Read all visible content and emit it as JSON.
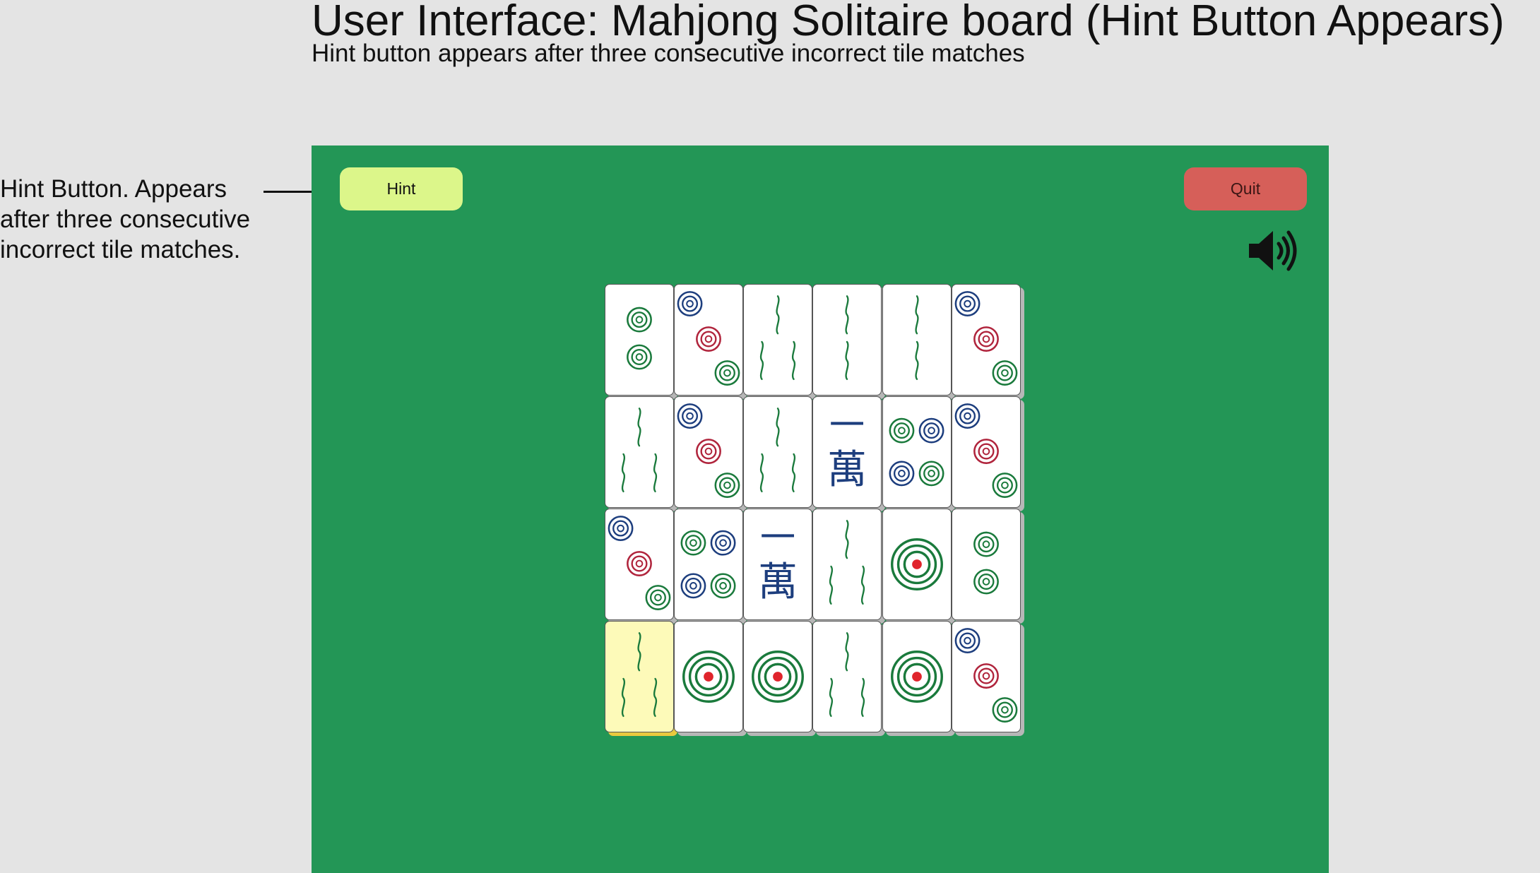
{
  "header": {
    "title": "User Interface: Mahjong Solitaire board (Hint Button Appears)",
    "subtitle": "Hint button appears after three consecutive incorrect tile matches"
  },
  "annotation": {
    "text": "Hint Button. Appears after three consecutive incorrect tile matches."
  },
  "toolbar": {
    "hint_label": "Hint",
    "quit_label": "Quit",
    "sound_icon": "speaker-volume-icon"
  },
  "colors": {
    "page_background": "#e4e4e4",
    "board_background": "#239656",
    "hint_button": "#dcf68a",
    "quit_button": "#d65f59",
    "tile_face": "#ffffff",
    "tile_selected": "#fdfab9",
    "dot_green": "#1a7a3c",
    "dot_blue": "#1d3e7e",
    "dot_red": "#b0243c",
    "bamboo_green": "#1a7a3c",
    "wan_blue": "#1d3e7e"
  },
  "wan_glyphs": {
    "top": "一",
    "bottom": "萬"
  },
  "tiles": {
    "rows": [
      [
        "dots-2",
        "dots-3",
        "bamboo-3",
        "bamboo-2",
        "bamboo-2",
        "dots-3"
      ],
      [
        "bamboo-3",
        "dots-3",
        "bamboo-3",
        "character-1",
        "dots-4",
        "dots-3"
      ],
      [
        "dots-3",
        "dots-4",
        "character-1",
        "bamboo-3",
        "dots-1",
        "dots-2"
      ],
      [
        "bamboo-3",
        "dots-1",
        "dots-1",
        "bamboo-3",
        "dots-1",
        "dots-3"
      ]
    ],
    "selected": {
      "row": 3,
      "col": 0
    }
  }
}
